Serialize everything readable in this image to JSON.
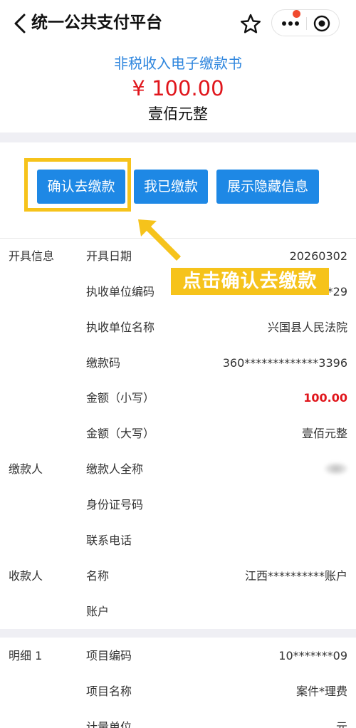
{
  "navbar": {
    "title": "统一公共支付平台"
  },
  "summary": {
    "doc_title": "非税收入电子缴款书",
    "amount": "¥ 100.00",
    "amount_cn": "壹佰元整"
  },
  "buttons": {
    "confirm": "确认去缴款",
    "paid": "我已缴款",
    "toggle": "展示隐藏信息"
  },
  "annotation": "点击确认去缴款",
  "sections": {
    "issue": "开具信息",
    "payer": "缴款人",
    "payee": "收款人",
    "detail": "明细 1"
  },
  "rows": [
    {
      "label": "开具日期",
      "value": "20260302"
    },
    {
      "label": "执收单位编码",
      "value": "**29"
    },
    {
      "label": "执收单位名称",
      "value": "兴国县人民法院"
    },
    {
      "label": "缴款码",
      "value": "360*************3396"
    },
    {
      "label": "金额（小写）",
      "value": "100.00"
    },
    {
      "label": "金额（大写）",
      "value": "壹佰元整"
    },
    {
      "label": "缴款人全称",
      "value": ""
    },
    {
      "label": "身份证号码",
      "value": ""
    },
    {
      "label": "联系电话",
      "value": ""
    },
    {
      "label": "名称",
      "value": "江西**********账户"
    },
    {
      "label": "账户",
      "value": ""
    },
    {
      "label": "项目编码",
      "value": "10*******09"
    },
    {
      "label": "项目名称",
      "value": "案件*理费"
    },
    {
      "label": "计量单位",
      "value": "元"
    }
  ],
  "colors": {
    "primary": "#1e88e5",
    "title_blue": "#2f86de",
    "amount_red": "#e0161c",
    "highlight_yellow": "#f6c31b",
    "page_gap": "#efeff4"
  },
  "icons": [
    "back-icon",
    "star-icon",
    "more-icon",
    "target-icon",
    "arrow-icon"
  ]
}
